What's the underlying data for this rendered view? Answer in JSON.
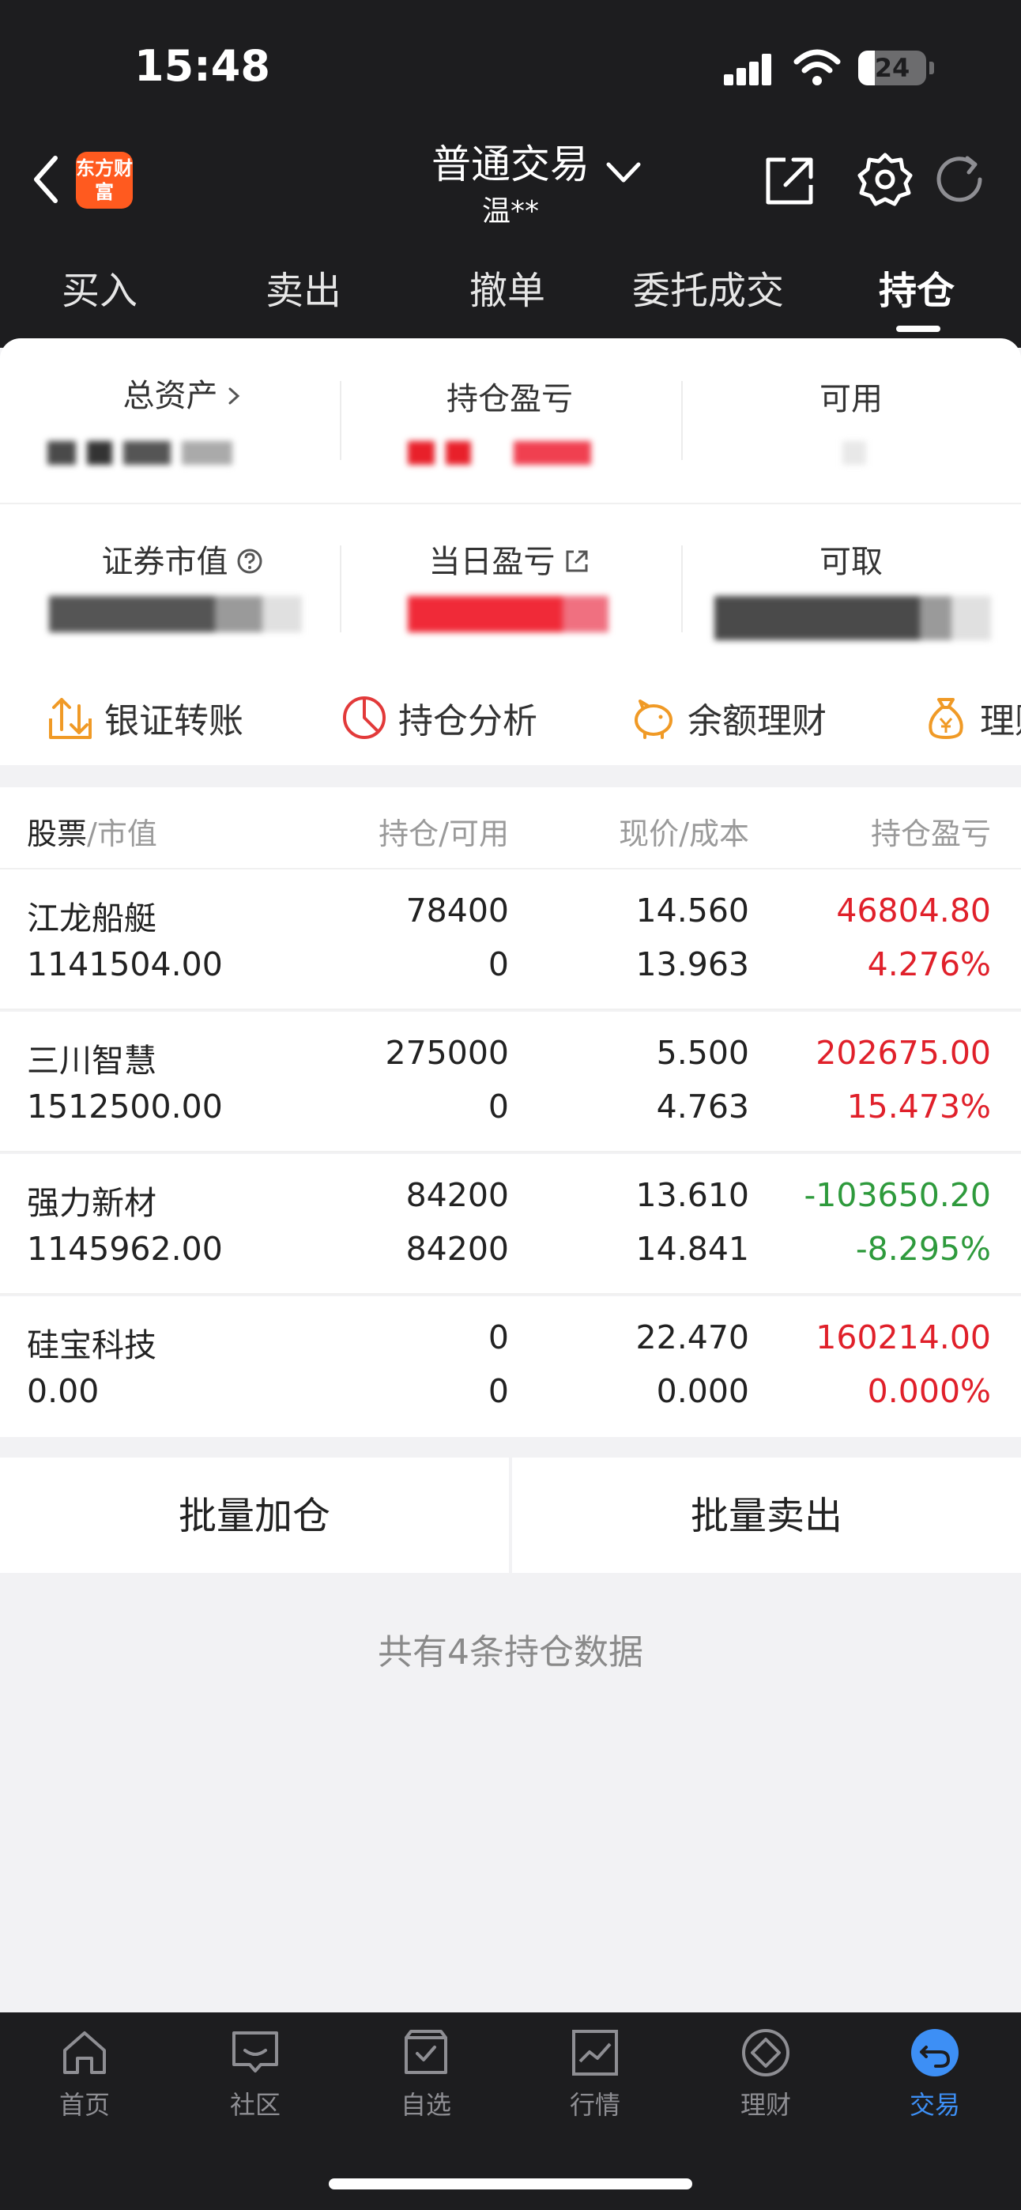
{
  "status_bar": {
    "time": "15:48",
    "battery": "24",
    "battery_level": 0.24
  },
  "header": {
    "logo_text": "东方财富",
    "title": "普通交易",
    "account_name": "温**"
  },
  "tabs": [
    {
      "label": "买入"
    },
    {
      "label": "卖出"
    },
    {
      "label": "撤单"
    },
    {
      "label": "委托成交"
    },
    {
      "label": "持仓",
      "active": true
    }
  ],
  "summary": {
    "total_assets_label": "总资产",
    "position_pl_label": "持仓盈亏",
    "available_label": "可用",
    "market_value_label": "证券市值",
    "daily_pl_label": "当日盈亏",
    "withdrawable_label": "可取"
  },
  "quick_actions": [
    {
      "label": "银证转账",
      "icon": "transfer-icon"
    },
    {
      "label": "持仓分析",
      "icon": "pie-chart-icon"
    },
    {
      "label": "余额理财",
      "icon": "piggy-bank-icon"
    },
    {
      "label": "理财",
      "icon": "money-bag-icon"
    }
  ],
  "table": {
    "headers": {
      "stock": "股票",
      "market_value": "/市值",
      "position": "持仓",
      "available": "/可用",
      "price": "现价",
      "cost": "/成本",
      "pl": "持仓盈亏"
    },
    "rows": [
      {
        "name": "江龙船艇",
        "market_value": "1141504.00",
        "position": "78400",
        "available": "0",
        "price": "14.560",
        "cost": "13.963",
        "pl": "46804.80",
        "pl_pct": "4.276%",
        "direction": "up"
      },
      {
        "name": "三川智慧",
        "market_value": "1512500.00",
        "position": "275000",
        "available": "0",
        "price": "5.500",
        "cost": "4.763",
        "pl": "202675.00",
        "pl_pct": "15.473%",
        "direction": "up"
      },
      {
        "name": "强力新材",
        "market_value": "1145962.00",
        "position": "84200",
        "available": "84200",
        "price": "13.610",
        "cost": "14.841",
        "pl": "-103650.20",
        "pl_pct": "-8.295%",
        "direction": "down"
      },
      {
        "name": "硅宝科技",
        "market_value": "0.00",
        "position": "0",
        "available": "0",
        "price": "22.470",
        "cost": "0.000",
        "pl": "160214.00",
        "pl_pct": "0.000%",
        "direction": "up"
      }
    ]
  },
  "actions": {
    "batch_add": "批量加仓",
    "batch_sell": "批量卖出"
  },
  "footer_note": "共有4条持仓数据",
  "bottom_nav": [
    {
      "label": "首页",
      "icon": "home-icon"
    },
    {
      "label": "社区",
      "icon": "chat-icon"
    },
    {
      "label": "自选",
      "icon": "watchlist-icon"
    },
    {
      "label": "行情",
      "icon": "market-chart-icon"
    },
    {
      "label": "理财",
      "icon": "diamond-icon"
    },
    {
      "label": "交易",
      "icon": "trade-icon",
      "active": true
    }
  ],
  "colors": {
    "header_bg": "#1d1d1f",
    "gain": "#e0202a",
    "loss": "#2e9a3c",
    "accent": "#3d8ff5",
    "brand": "#ff5a1f"
  }
}
